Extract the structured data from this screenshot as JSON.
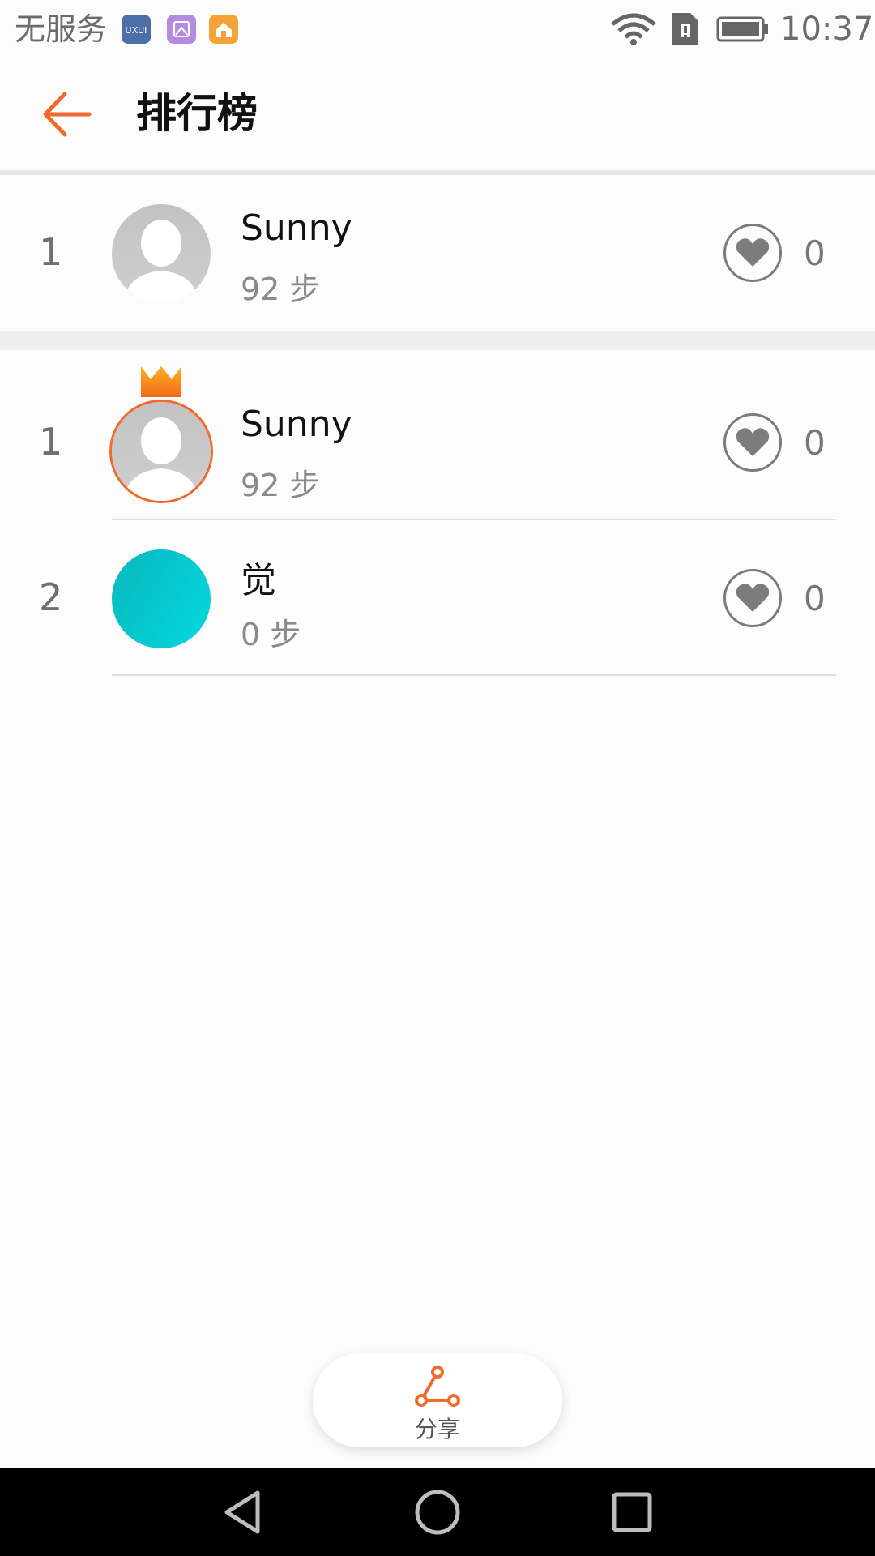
{
  "status_bar": {
    "carrier": "无服务",
    "time": "10:37",
    "icons": [
      "uxui-app-icon",
      "gallery-app-icon",
      "home-app-icon",
      "wifi-icon",
      "sim-card-icon",
      "battery-icon"
    ]
  },
  "header": {
    "title": "排行榜",
    "accent_color": "#f06a2d"
  },
  "my_rank": {
    "rank": "1",
    "name": "Sunny",
    "steps": "92 步",
    "likes": "0"
  },
  "leaderboard": [
    {
      "rank": "1",
      "name": "Sunny",
      "steps": "92 步",
      "likes": "0",
      "crown": true,
      "avatar": "person-avatar"
    },
    {
      "rank": "2",
      "name": "觉",
      "steps": "0 步",
      "likes": "0",
      "crown": false,
      "avatar": "teal-avatar"
    }
  ],
  "share": {
    "label": "分享"
  },
  "nav": {
    "icons": [
      "back-triangle-icon",
      "home-circle-icon",
      "recents-square-icon"
    ]
  }
}
